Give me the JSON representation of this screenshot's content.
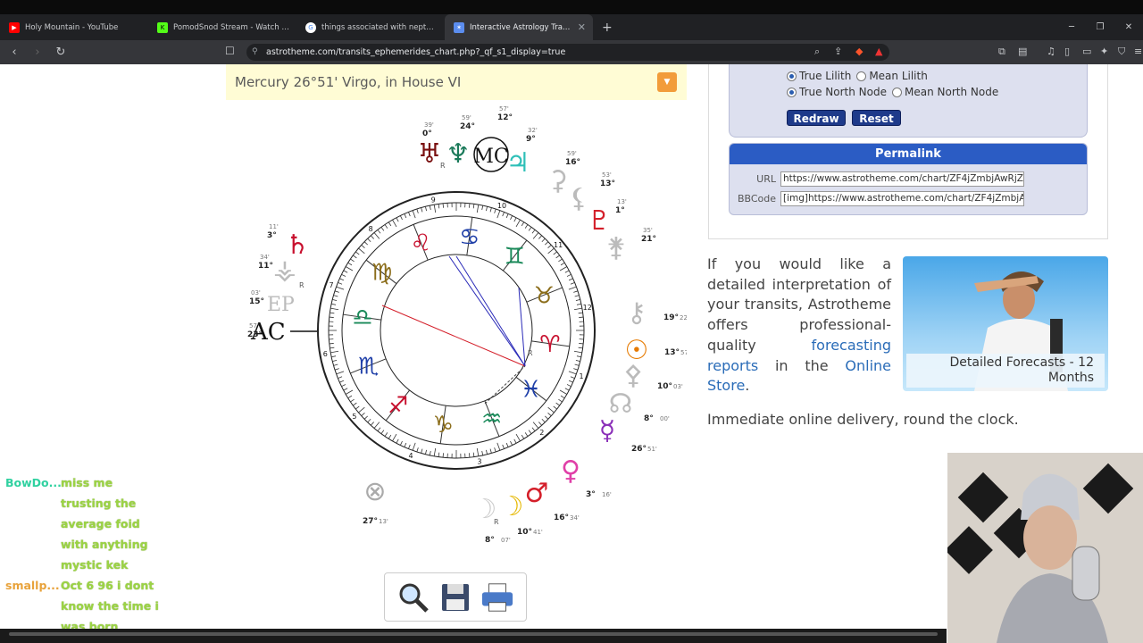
{
  "browser": {
    "tabs": [
      {
        "title": "Holy Mountain - YouTube",
        "favicon_color": "#ff0000",
        "active": false
      },
      {
        "title": "PomodSnod Stream - Watch Live",
        "favicon_color": "#53fc18",
        "active": false
      },
      {
        "title": "things associated with neptune - Go",
        "favicon_color": "#4285f4",
        "active": false
      },
      {
        "title": "Interactive Astrology Transits, Ep",
        "favicon_color": "#5b8def",
        "active": true
      }
    ],
    "new_tab": "+",
    "url": "astrotheme.com/transits_ephemerides_chart.php?_qf_s1_display=true"
  },
  "chat": [
    {
      "user": "BowDo...",
      "user_color": "#2fd1a0",
      "lines": [
        "miss me",
        "trusting the",
        "average foid",
        "with anything",
        "mystic kek"
      ]
    },
    {
      "user": "smallp...",
      "user_color": "#e8a23a",
      "lines": [
        "Oct 6 96 i dont",
        "know the time i",
        "was born"
      ]
    }
  ],
  "planet_bar": {
    "text": "Mercury 26°51' Virgo, in House VI"
  },
  "chart": {
    "house_numbers": [
      "10",
      "9",
      "8",
      "7",
      "6",
      "5",
      "4",
      "3",
      "2",
      "1",
      "12",
      "11"
    ],
    "ac_label": "AC",
    "mc_label": "MC",
    "ep_label": "EP",
    "degree_labels": [
      {
        "deg": "0°",
        "min": "39'"
      },
      {
        "deg": "24°",
        "min": "59'"
      },
      {
        "deg": "12°",
        "min": "57'"
      },
      {
        "deg": "9°",
        "min": "32'"
      },
      {
        "deg": "16°",
        "min": "59'"
      },
      {
        "deg": "13°",
        "min": "53'"
      },
      {
        "deg": "1°",
        "min": "13'"
      },
      {
        "deg": "21°",
        "min": "35'"
      },
      {
        "deg": "3°",
        "min": "11'"
      },
      {
        "deg": "11°",
        "min": "34'"
      },
      {
        "deg": "15°",
        "min": "03'"
      },
      {
        "deg": "23°",
        "min": "57'"
      },
      {
        "deg": "19°",
        "min": "22'"
      },
      {
        "deg": "13°",
        "min": "57'"
      },
      {
        "deg": "10°",
        "min": "03'"
      },
      {
        "deg": "8°",
        "min": "00'"
      },
      {
        "deg": "26°",
        "min": "51'"
      },
      {
        "deg": "3°",
        "min": "16'"
      },
      {
        "deg": "16°",
        "min": "34'"
      },
      {
        "deg": "10°",
        "min": "41'"
      },
      {
        "deg": "8°",
        "min": "07'"
      },
      {
        "deg": "27°",
        "min": "13'"
      }
    ],
    "retro": "R"
  },
  "options": {
    "lilith": [
      {
        "label": "True Lilith",
        "checked": true
      },
      {
        "label": "Mean Lilith",
        "checked": false
      }
    ],
    "node": [
      {
        "label": "True North Node",
        "checked": true
      },
      {
        "label": "Mean North Node",
        "checked": false
      }
    ],
    "redraw": "Redraw",
    "reset": "Reset"
  },
  "permalink": {
    "title": "Permalink",
    "url_label": "URL",
    "url_value": "https://www.astrotheme.com/chart/ZF4jZmbjAwRjZ",
    "bbcode_label": "BBCode",
    "bbcode_value": "[img]https://www.astrotheme.com/chart/ZF4jZmbjA"
  },
  "info": {
    "text_before": "If you would like a detailed interpretation of your transits, Astrotheme offers professional-quality",
    "link1": "forecasting reports",
    "text_mid": "in the",
    "link2": "Online Store",
    "text_end": ".",
    "delivery": "Immediate online delivery, round the clock."
  },
  "promo": {
    "caption": "Detailed Forecasts - 12 Months"
  }
}
